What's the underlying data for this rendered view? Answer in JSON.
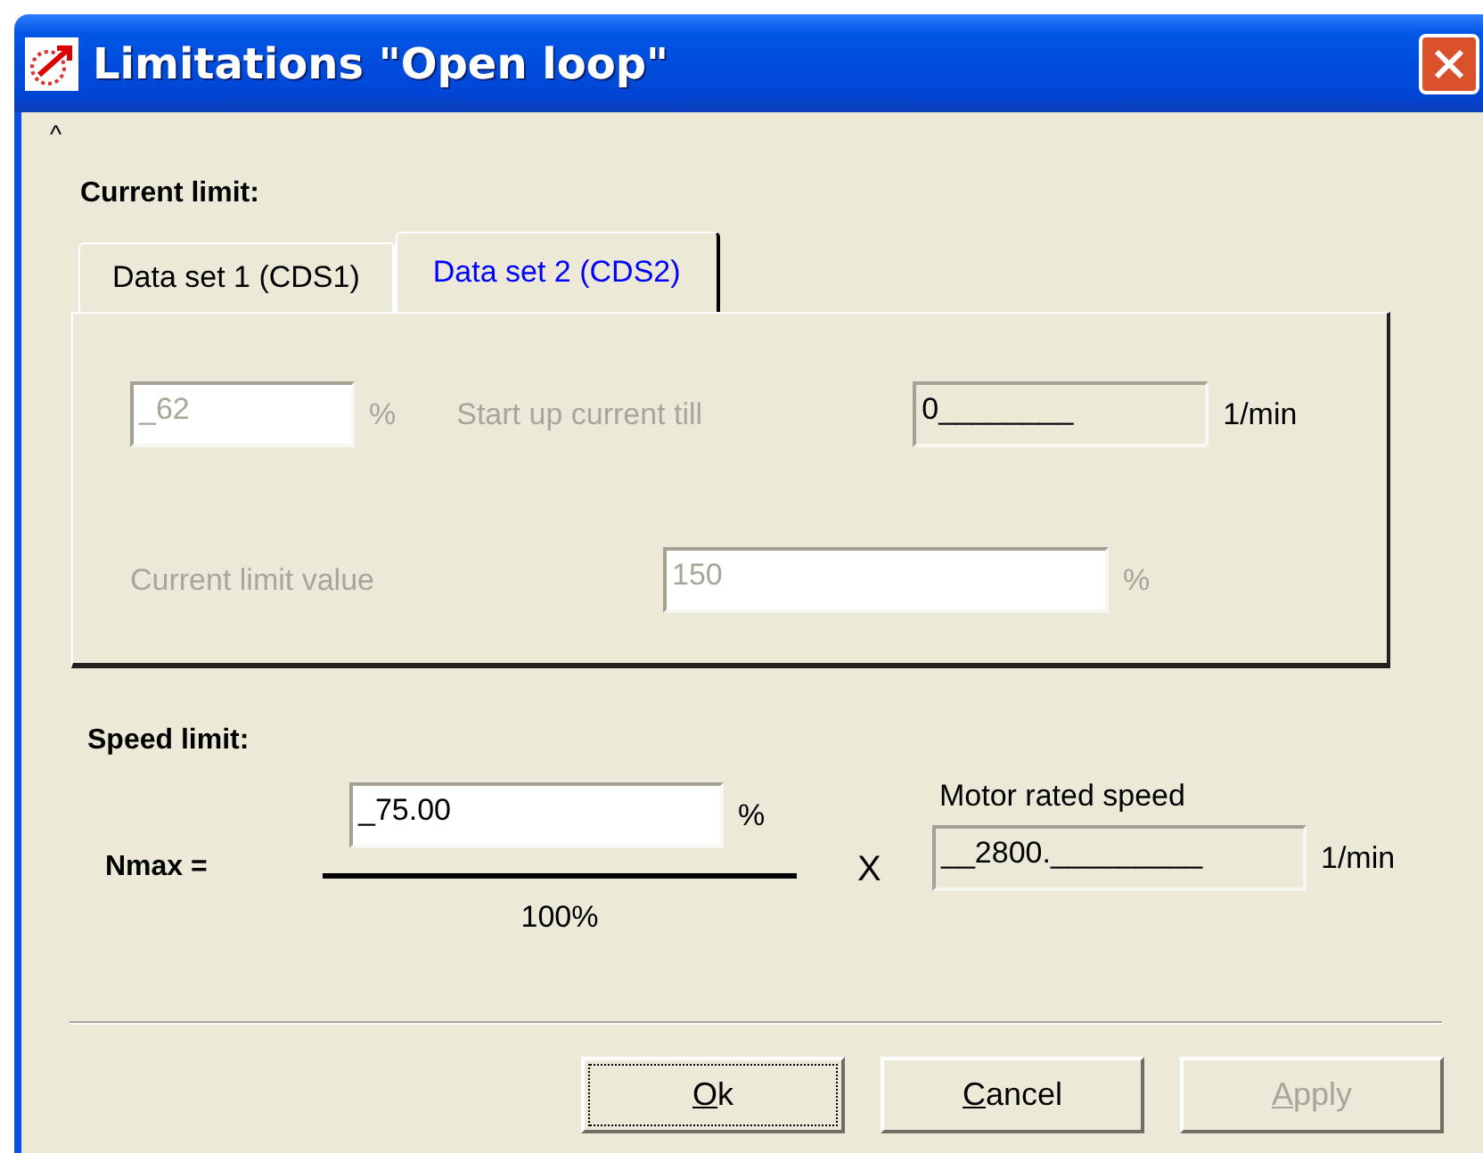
{
  "window": {
    "title": "Limitations \"Open loop\"",
    "collapse_mark": "^"
  },
  "current_limit": {
    "heading": "Current limit:",
    "tabs": [
      {
        "label": "Data set 1 (CDS1)",
        "selected": false
      },
      {
        "label": "Data set 2 (CDS2)",
        "selected": true
      }
    ],
    "percent_field": {
      "value": "_62",
      "unit": "%",
      "disabled": true,
      "readonly": false
    },
    "start_up": {
      "label": "Start up current till",
      "disabled": true
    },
    "start_up_field": {
      "value": "0________",
      "unit": "1/min",
      "disabled": false,
      "readonly": true
    },
    "limit_value": {
      "label": "Current limit value",
      "disabled": true
    },
    "limit_value_field": {
      "value": "150",
      "unit": "%",
      "disabled": true,
      "readonly": false
    }
  },
  "speed_limit": {
    "heading": "Speed limit:",
    "formula_label": "Nmax =",
    "numerator_field": {
      "value": "_75.00",
      "unit": "%",
      "disabled": false,
      "readonly": false
    },
    "denominator": "100%",
    "times": "X",
    "motor_label": "Motor rated speed",
    "motor_field": {
      "value": "__2800._________",
      "unit": "1/min",
      "disabled": false,
      "readonly": true
    }
  },
  "buttons": [
    {
      "label": "Ok",
      "disabled": false,
      "focused": true
    },
    {
      "label": "Cancel",
      "disabled": false,
      "focused": false
    },
    {
      "label": "Apply",
      "disabled": true,
      "focused": false
    }
  ]
}
